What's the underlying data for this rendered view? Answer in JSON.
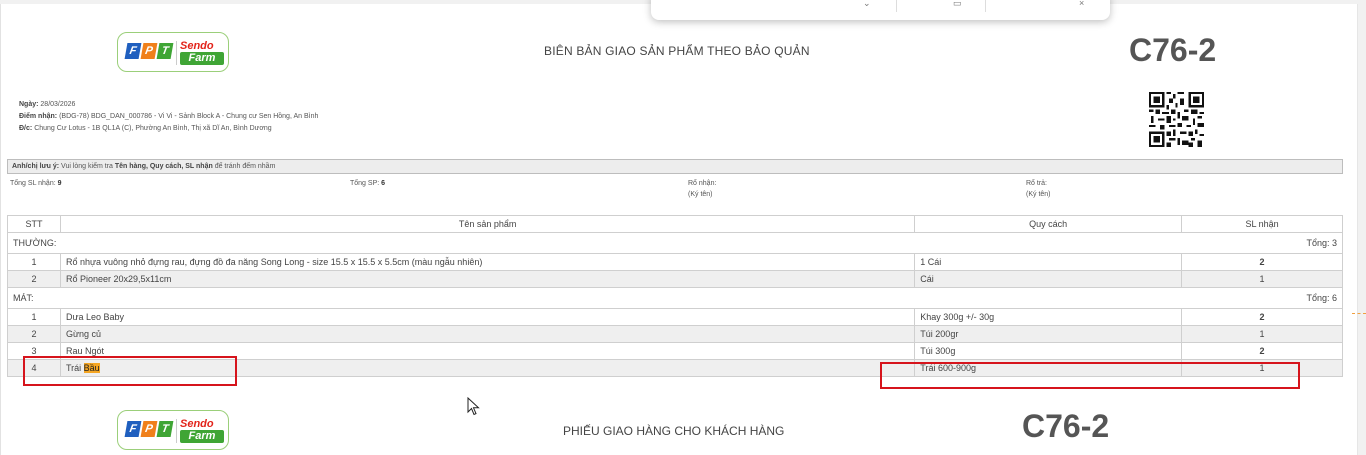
{
  "header": {
    "logo": {
      "fpt_letters": [
        "F",
        "P",
        "T"
      ],
      "fpt_colors": [
        "#1f5fbf",
        "#f0801b",
        "#3fa535"
      ],
      "sendo": "Sendo",
      "farm": "Farm"
    },
    "title": "BIÊN BẢN GIAO SẢN PHẨM THEO BẢO QUẢN",
    "code": "C76-2",
    "qr_icon": "qr-code"
  },
  "info": {
    "date_label": "Ngày:",
    "date_value": "28/03/2026",
    "receive_label": "Điểm nhận:",
    "receive_value": "(BDG-78) BDG_DAN_000786 - Vi Vi - Sảnh Block A - Chung cư Sen Hồng, An Bình",
    "address_label": "Đ/c:",
    "address_value": "Chung Cư Lotus - 1B QL1A (C), Phường An Bình, Thị xã Dĩ An, Bình Dương"
  },
  "notice": {
    "label": "Anh/chị lưu ý:",
    "text1": "Vui lòng kiểm tra",
    "bold": "Tên hàng, Quy cách, SL nhận",
    "text2": "để tránh đếm nhầm"
  },
  "summary": {
    "total_qty_label": "Tổng SL nhận:",
    "total_qty": "9",
    "total_sp_label": "Tổng SP:",
    "total_sp": "6",
    "ro_nhan": "Rổ nhận:",
    "ro_nhan_sign": "(Ký tên)",
    "ro_tra": "Rổ trả:",
    "ro_tra_sign": "(Ký tên)"
  },
  "table": {
    "headers": [
      "STT",
      "Tên sản phẩm",
      "Quy cách",
      "SL nhận"
    ],
    "groups": [
      {
        "name": "THƯỜNG:",
        "total": "Tổng: 3",
        "rows": [
          {
            "stt": "1",
            "name": "Rổ nhựa vuông nhỏ đựng rau, đựng đồ đa năng Song Long - size 15.5 x 15.5 x 5.5cm (màu ngẫu nhiên)",
            "spec": "1 Cái",
            "qty": "2"
          },
          {
            "stt": "2",
            "name": "Rổ Pioneer 20x29,5x11cm",
            "spec": "Cái",
            "qty": "1"
          }
        ]
      },
      {
        "name": "MÁT:",
        "total": "Tổng: 6",
        "rows": [
          {
            "stt": "1",
            "name": "Dưa Leo Baby",
            "spec": "Khay 300g +/- 30g",
            "qty": "2"
          },
          {
            "stt": "2",
            "name": "Gừng củ",
            "spec": "Túi 200gr",
            "qty": "1"
          },
          {
            "stt": "3",
            "name": "Rau Ngót",
            "spec": "Túi 300g",
            "qty": "2"
          },
          {
            "stt": "4",
            "name_prefix": "Trái ",
            "name_highlight": "Bầu",
            "spec": "Trái 600-900g",
            "qty": "1"
          }
        ]
      }
    ]
  },
  "footer": {
    "title": "PHIẾU GIAO HÀNG CHO KHÁCH HÀNG",
    "code": "C76-2"
  },
  "colors": {
    "highlight": "#f5a623",
    "annotation_red": "#d6141c"
  }
}
